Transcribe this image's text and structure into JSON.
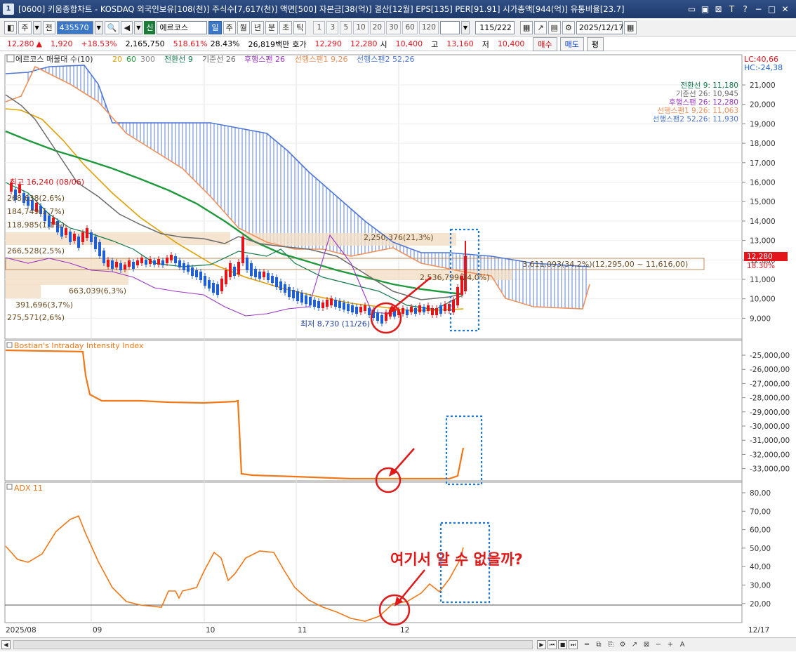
{
  "titlebar": {
    "app_number": "1",
    "title": "[0600] 키움종합차트 - KOSDAQ 외국인보유[108(천)] 주식수[7,617(천)] 액면[500] 자본금[38(억)] 결산[12월] EPS[135] PER[91.91] 시가총액[944(억)] 유통비율[23.7]",
    "controls": [
      "restore-icon",
      "pin-icon",
      "lock-icon",
      "font-icon",
      "help-icon",
      "minimize-icon",
      "maximize-icon",
      "close-icon"
    ]
  },
  "toolbar": {
    "jong_label": "주",
    "jeon_label": "전",
    "code": "435570",
    "shin_label": "신",
    "stock_name": "에르코스",
    "periods": [
      "일",
      "주",
      "월",
      "년",
      "분",
      "초",
      "틱"
    ],
    "active_period": "일",
    "intervals": [
      "1",
      "3",
      "5",
      "10",
      "20",
      "30",
      "60",
      "120"
    ],
    "count": "115/222",
    "date": "2025/12/17"
  },
  "pricebar": {
    "price": "12,280",
    "change": "1,920",
    "change_pct": "+18.53%",
    "volume": "2,165,750",
    "volume_ratio": "518.61%",
    "turnover": "28.43%",
    "amount": "26,819백만",
    "hoga_label": "호가",
    "ask": "12,290",
    "bid": "12,280",
    "open_label": "시",
    "open": "10,400",
    "high_label": "고",
    "high": "13,160",
    "low_label": "저",
    "low": "10,400",
    "buy_label": "매수",
    "sell_label": "매도",
    "eval_label": "평"
  },
  "legend": {
    "name": "에르코스 매물대 수(10)",
    "ma": [
      "20",
      "60",
      "300"
    ],
    "ichimoku": [
      "전환선 9",
      "기준선 26",
      "후행스팬 26",
      "선행스팬1 9,26",
      "선행스팬2 52,26"
    ],
    "lc": "LC:40,66",
    "hc": "HC:-24,38"
  },
  "ichimoku_readout": [
    "전환선 9: 11,180",
    "기준선 26: 10,945",
    "후행스팬 26: 12,280",
    "선행스팬1 9,26: 11,063",
    "선행스팬2 52,26: 11,930"
  ],
  "price_axis": [
    "21,000",
    "20,000",
    "19,000",
    "18,000",
    "17,000",
    "16,000",
    "15,000",
    "14,000",
    "13,000",
    "12,000",
    "11,000",
    "10,000",
    "9,000"
  ],
  "current_price_tag": {
    "price": "12,280",
    "pct": "18.30%"
  },
  "annotations": {
    "high": "최고 16,240 (08/06)",
    "low": "최저 8,730 (11/26)",
    "volume_profile": [
      "268,638(2,6%)",
      "184,749(1,7%)",
      "118,985(1,1%)",
      "266,528(2,5%)",
      "663,039(6,3%)",
      "391,696(3,7%)",
      "275,571(2,6%)",
      "2,250,376(21,3%)",
      "2,536,799(24,0%)",
      "3,611,093(34,2%)(12,295,00 ~ 11,616,00)"
    ],
    "question": "여기서 알 수 없을까?"
  },
  "bii_panel": {
    "title": "Bostian's Intraday Intensity Index",
    "axis": [
      "-25,000,00",
      "-26,000,00",
      "-27,000,00",
      "-28,000,00",
      "-29,000,00",
      "-30,000,00",
      "-31,000,00",
      "-32,000,00",
      "-33,000,00"
    ]
  },
  "adx_panel": {
    "title": "ADX 11",
    "axis": [
      "80,00",
      "70,00",
      "60,00",
      "50,00",
      "40,00",
      "30,00",
      "20,00"
    ]
  },
  "date_axis": [
    "2025/08",
    "09",
    "10",
    "11",
    "12"
  ],
  "date_axis_right": "12/17",
  "colors": {
    "up": "#e3141c",
    "down": "#1f5fd6",
    "ma20": "#e0a000",
    "ma60": "#1e9a3c",
    "tenkan": "#127a4a",
    "kijun": "#6b6b6b",
    "chikou": "#9a36c4",
    "span1": "#f0905a",
    "span2": "#4d76d8",
    "bii": "#f07818",
    "adx": "#f07818",
    "annotation": "#e01818",
    "highlight": "#1e78d8"
  }
}
